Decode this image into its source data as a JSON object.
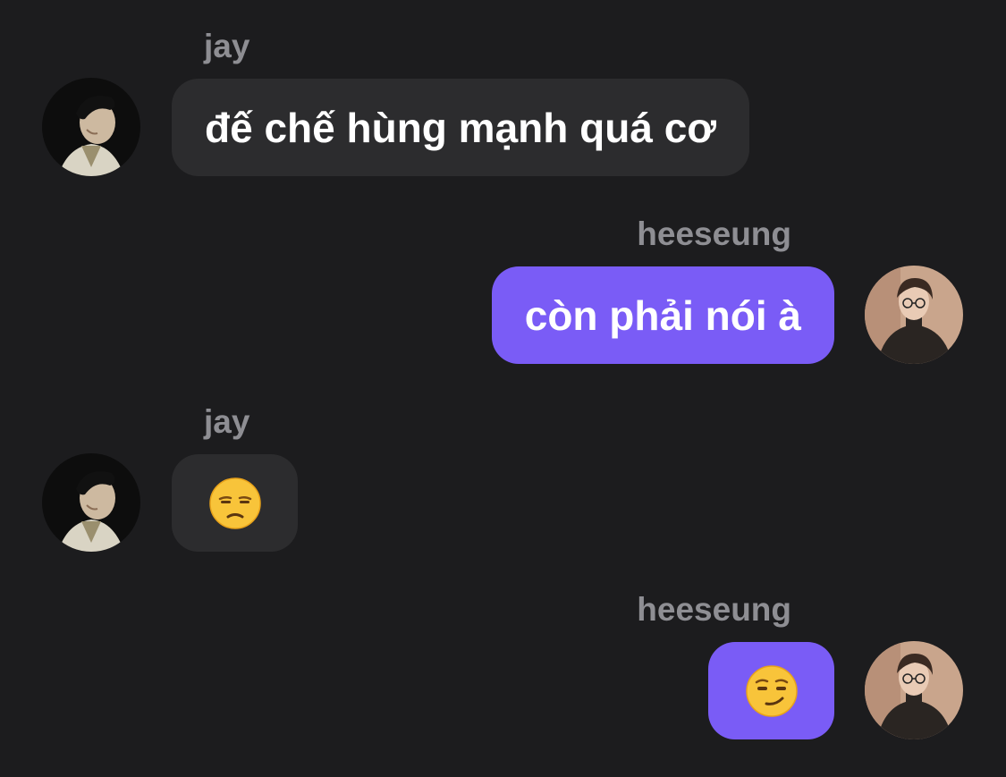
{
  "messages": [
    {
      "sender": "jay",
      "side": "left",
      "text": "đế chế hùng mạnh quá cơ",
      "avatar": "jay-avatar"
    },
    {
      "sender": "heeseung",
      "side": "right",
      "text": "còn phải nói à",
      "avatar": "heeseung-avatar"
    },
    {
      "sender": "jay",
      "side": "left",
      "emoji": "unamused-face",
      "avatar": "jay-avatar"
    },
    {
      "sender": "heeseung",
      "side": "right",
      "emoji": "smirking-face",
      "avatar": "heeseung-avatar"
    }
  ],
  "colors": {
    "background": "#1c1c1e",
    "incoming_bubble": "#2c2c2e",
    "outgoing_bubble": "#7a5cf6",
    "sender_name": "#8e8e93",
    "message_text": "#ffffff"
  }
}
